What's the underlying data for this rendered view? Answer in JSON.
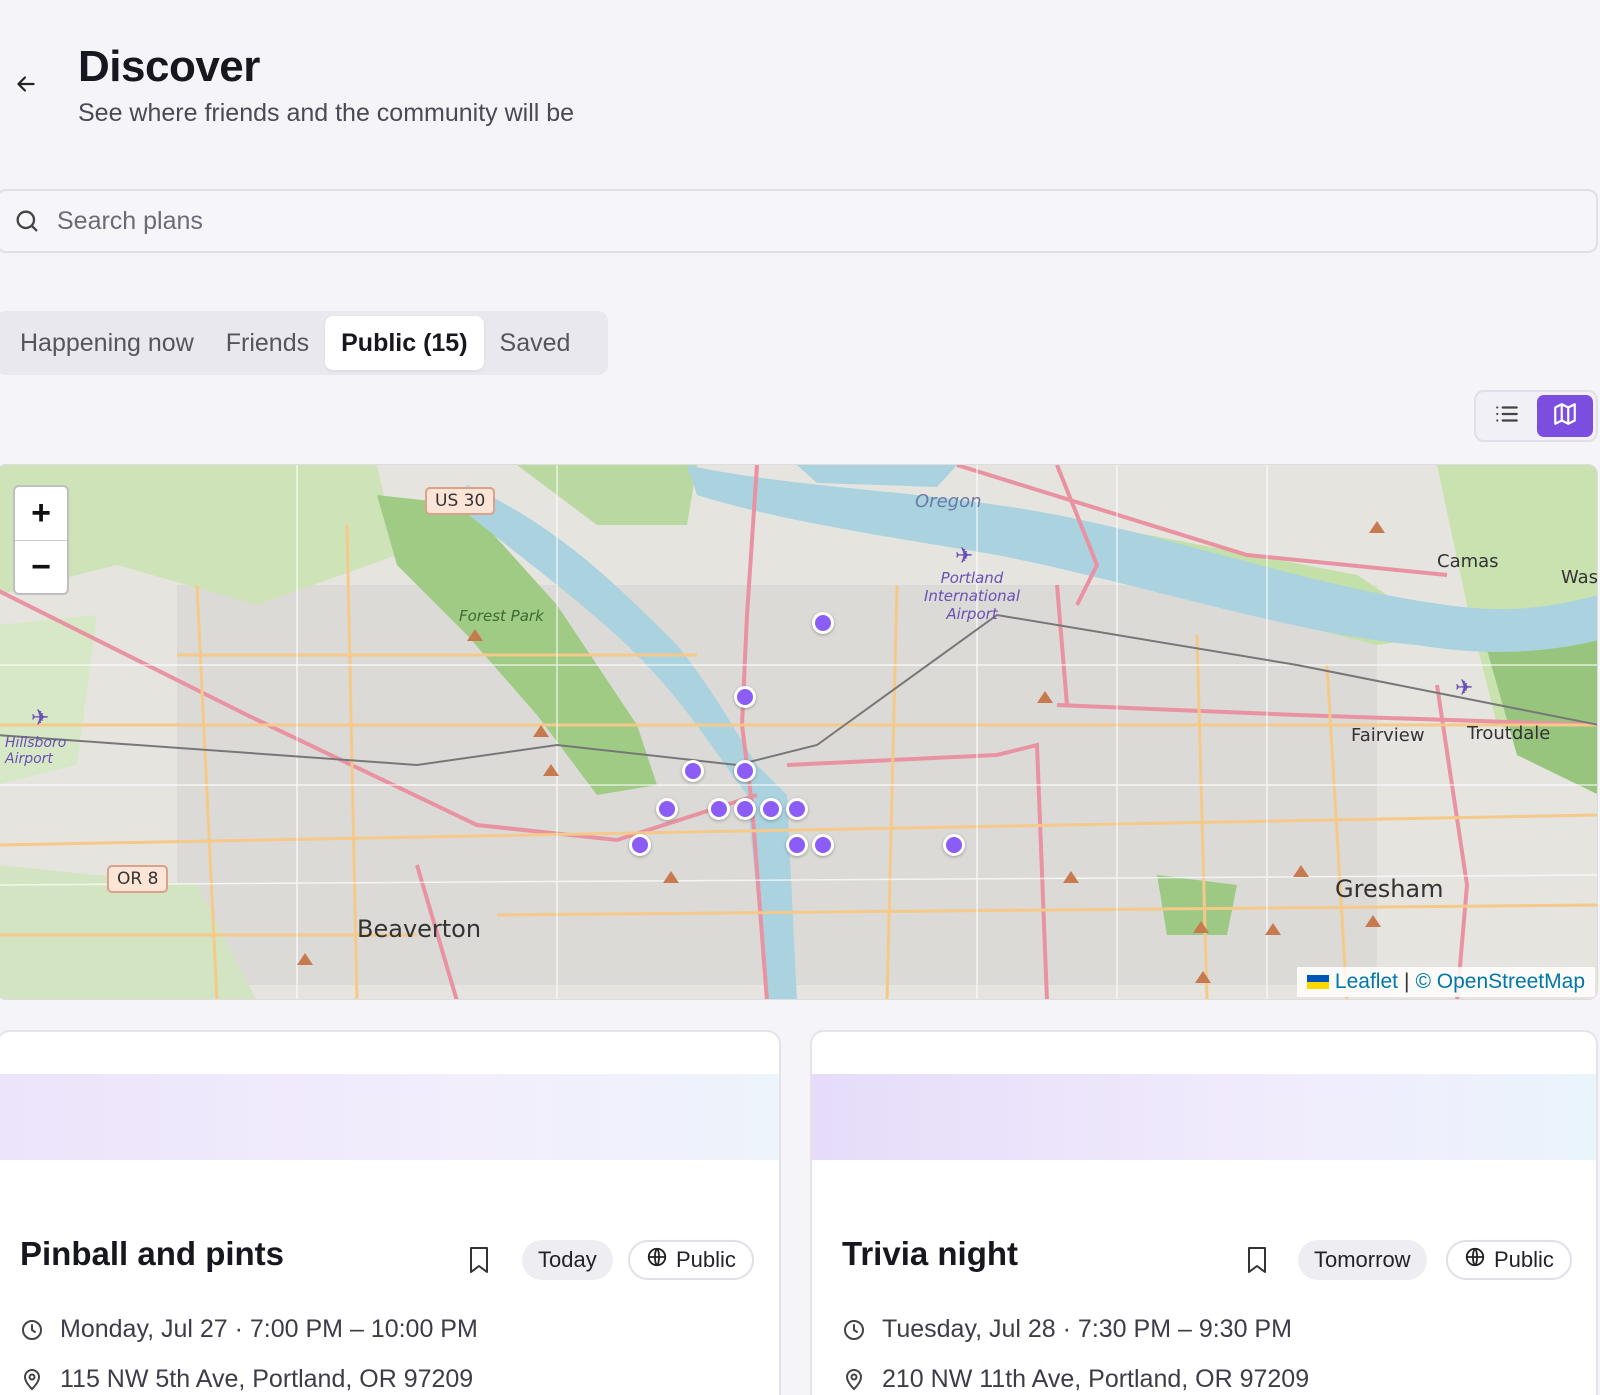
{
  "header": {
    "back_icon": "arrow-left-icon",
    "title": "Discover",
    "subtitle": "See where friends and the community will be"
  },
  "search": {
    "placeholder": "Search plans",
    "value": "",
    "icon": "search-icon"
  },
  "tabs": [
    {
      "label": "Happening now",
      "active": false
    },
    {
      "label": "Friends",
      "active": false
    },
    {
      "label": "Public (15)",
      "active": true
    },
    {
      "label": "Saved",
      "active": false
    }
  ],
  "view_toggle": {
    "list_icon": "list-icon",
    "map_icon": "map-icon",
    "active": "map"
  },
  "map": {
    "zoom_in": "+",
    "zoom_out": "−",
    "attribution_leaflet": "Leaflet",
    "attribution_sep": "|",
    "attribution_osm": "© OpenStreetMap",
    "place_labels": {
      "beaverton": "Beaverton",
      "gresham": "Gresham",
      "fairview": "Fairview",
      "troutdale": "Troutdale",
      "camas": "Camas",
      "was": "Was",
      "forest_park": "Forest Park",
      "oregon": "Oregon",
      "pdx_airport": "Portland International Airport",
      "hillsboro_airport": "Hillsboro Airport"
    },
    "shields": {
      "us30": "US 30",
      "or8": "OR 8"
    },
    "accent_color": "#8b5cf6",
    "marker_count": 15
  },
  "cards": [
    {
      "title": "Pinball and pints",
      "day": "Today",
      "visibility": "Public",
      "datetime": "Monday, Jul 27 · 7:00 PM – 10:00 PM",
      "address": "115 NW 5th Ave, Portland, OR 97209"
    },
    {
      "title": "Trivia night",
      "day": "Tomorrow",
      "visibility": "Public",
      "datetime": "Tuesday, Jul 28 · 7:30 PM – 9:30 PM",
      "address": "210 NW 11th Ave, Portland, OR 97209"
    }
  ]
}
